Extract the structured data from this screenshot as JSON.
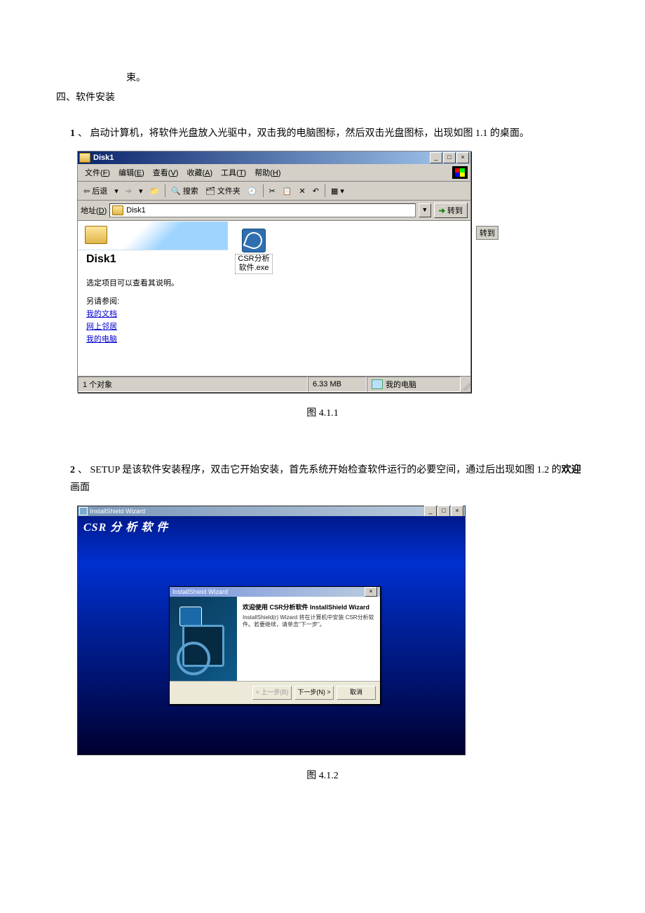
{
  "text": {
    "line_end": "束。",
    "section": "四、软件安装",
    "item1_num": "1",
    "item1_sep": "、",
    "item1": "启动计算机，将软件光盘放入光驱中，双击我的电脑图标，然后双击光盘图标，出现如图 1.1 的桌面。",
    "caption1": "图 4.1.1",
    "item2_num": "2",
    "item2_sep": "、",
    "item2_a": "SETUP 是该软件安装程序，双击它开始安装，首先系统开始检查软件运行的必要空间，通过后出现如图 1.2 的",
    "item2_b": "欢迎",
    "item2_c": "画面",
    "caption2": "图 4.1.2"
  },
  "explorer": {
    "title": "Disk1",
    "btn_min": "_",
    "btn_max": "□",
    "btn_close": "×",
    "menu": {
      "file": "文件(F)",
      "edit": "编辑(E)",
      "view": "查看(V)",
      "fav": "收藏(A)",
      "tools": "工具(T)",
      "help": "帮助(H)"
    },
    "tb": {
      "back": "后退",
      "search": "搜索",
      "folders": "文件夹"
    },
    "addr_label": "地址(D)",
    "addr_value": "Disk1",
    "go": "转到",
    "side_btn": "转到",
    "lp_title": "Disk1",
    "lp_hint": "选定项目可以查看其说明。",
    "lp_see": "另请参阅:",
    "lp_link1": "我的文档",
    "lp_link2": "网上邻居",
    "lp_link3": "我的电脑",
    "file_name": "CSR分析软件.exe",
    "status_objects": "1 个对象",
    "status_size": "6.33 MB",
    "status_loc": "我的电脑"
  },
  "install": {
    "outer_title": "InstallShield Wizard",
    "brand": "CSR 分 析 软 件",
    "dlg_title": "InstallShield Wizard",
    "dlg_close": "×",
    "heading": "欢迎使用 CSR分析软件 InstallShield Wizard",
    "body": "InstallShield(r) Wizard 将在计算机中安装 CSR分析软件。若要继续，请单击\"下一步\"。",
    "btn_back": "< 上一步(B)",
    "btn_next": "下一步(N) >",
    "btn_cancel": "取消"
  }
}
